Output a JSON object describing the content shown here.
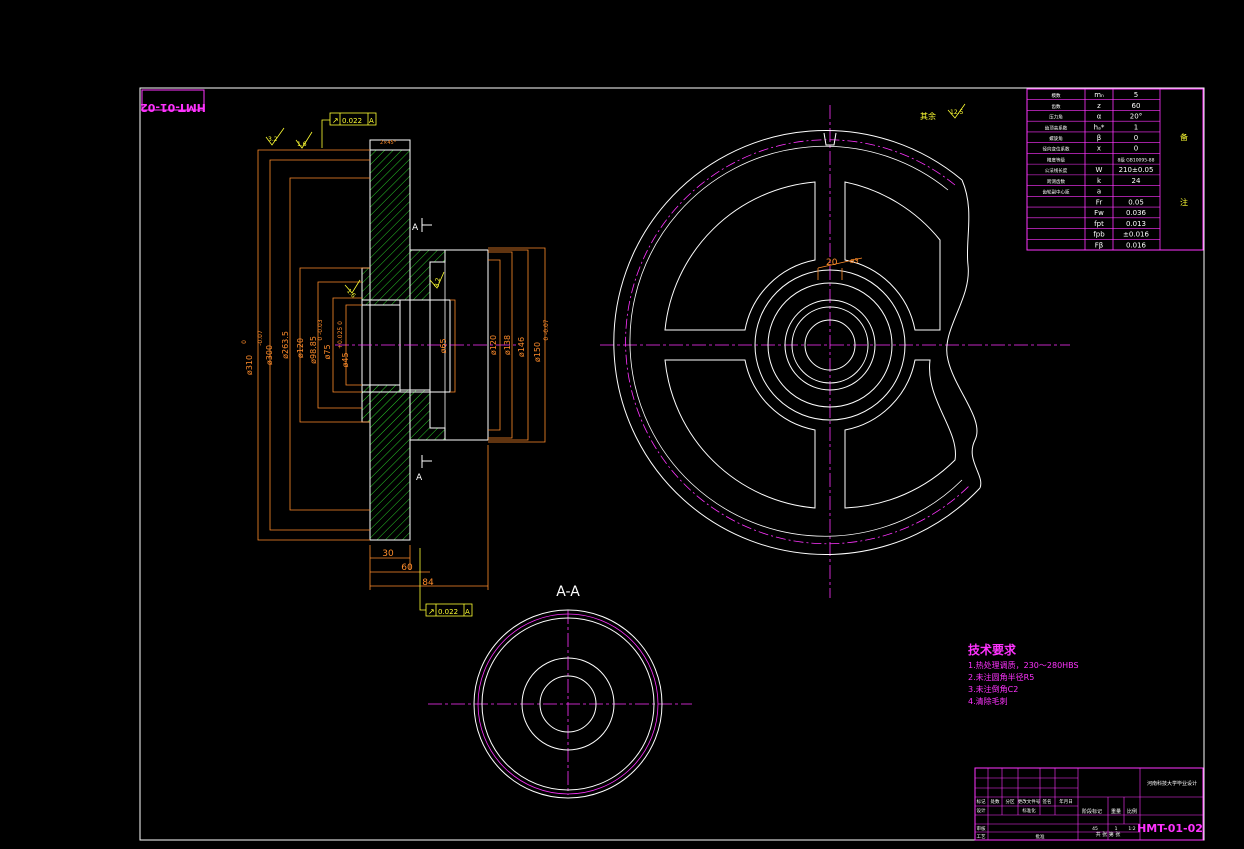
{
  "drawing_number": "HMT-01-02",
  "drawing_number_mirrored": "HMT-01-02",
  "section": {
    "title": "A-A",
    "cut_label": "A"
  },
  "tolerances": {
    "runout_1": {
      "value": "0.022",
      "datum": "A"
    },
    "runout_2": {
      "value": "0.022",
      "datum": "A"
    },
    "roughness_1": "3.2",
    "roughness_2": "1.6",
    "roughness_3": "1.6",
    "roughness_4": "3.2",
    "roughness_rest_label": "其余",
    "roughness_rest": "12.5",
    "chamfer": "2×45°"
  },
  "dims_left": {
    "d300": "ø300",
    "d310": "ø310",
    "d310_tol_top": "0",
    "d310_tol_bot": "-0.07",
    "d263": "ø263.5",
    "d120": "ø120",
    "d98": "ø98.85",
    "d75": "ø75",
    "d75_tol": "0 -0.03",
    "d45": "ø45",
    "d45_tol": "+0.025 0",
    "d65": "ø65",
    "d120r": "ø120",
    "d138": "ø138",
    "d146": "ø146",
    "d150": "ø150",
    "d150_tol": "0 -0.07",
    "l30": "30",
    "l60": "60",
    "l84": "84"
  },
  "dims_right": {
    "keyway_width": "20",
    "keyway_dim": "ø3"
  },
  "param_table": [
    {
      "label": "模数",
      "sym": "mₙ",
      "val": "5"
    },
    {
      "label": "齿数",
      "sym": "z",
      "val": "60"
    },
    {
      "label": "压力角",
      "sym": "α",
      "val": "20°"
    },
    {
      "label": "齿顶高系数",
      "sym": "hₐ*",
      "val": "1"
    },
    {
      "label": "螺旋角",
      "sym": "β",
      "val": "0"
    },
    {
      "label": "径向变位系数",
      "sym": "x",
      "val": "0"
    },
    {
      "label": "精度等级",
      "sym": "",
      "val": "8级 GB10095-88"
    },
    {
      "label": "公法线长度",
      "sym": "W",
      "val": "210±0.05"
    },
    {
      "label": "跨测齿数",
      "sym": "k",
      "val": "24"
    },
    {
      "label": "齿轮副中心距",
      "sym": "a",
      "val": ""
    },
    {
      "label": "",
      "sym": "Fr",
      "val": "0.05"
    },
    {
      "label": "",
      "sym": "Fw",
      "val": "0.036"
    },
    {
      "label": "",
      "sym": "fpt",
      "val": "0.013"
    },
    {
      "label": "",
      "sym": "fpb",
      "val": "±0.016"
    },
    {
      "label": "",
      "sym": "Fβ",
      "val": "0.016"
    }
  ],
  "param_side_1": "备",
  "param_side_2": "注",
  "tech_notes": {
    "title": "技术要求",
    "items": [
      "1.热处理调质，230～280HBS",
      "2.未注圆角半径R5",
      "3.未注倒角C2",
      "4.清除毛刺"
    ]
  },
  "title_block": {
    "school": "河南科技大学毕业设计",
    "part_number": "HMT-01-02",
    "scale_label": "比例",
    "scale": "1:2",
    "qty": "1",
    "material": "45",
    "row1": [
      "标记",
      "处数",
      "分区",
      "更改文件号",
      "签名",
      "年月日"
    ],
    "row2": [
      "设计",
      "",
      "",
      "标准化",
      "",
      ""
    ],
    "row3": [
      "审核",
      ""
    ],
    "row4": [
      "工艺",
      "",
      "批准"
    ],
    "stage": "阶段标记",
    "weight": "重量",
    "sheet": "共 张 第 张"
  },
  "colors": {
    "border": "#ffffff",
    "outline": "#ffffff",
    "hatch": "#33ff33",
    "dimension": "#ff8c2a",
    "centerline": "#ff33ff",
    "text_yellow": "#ffff33",
    "text_magenta": "#ff33ff"
  }
}
